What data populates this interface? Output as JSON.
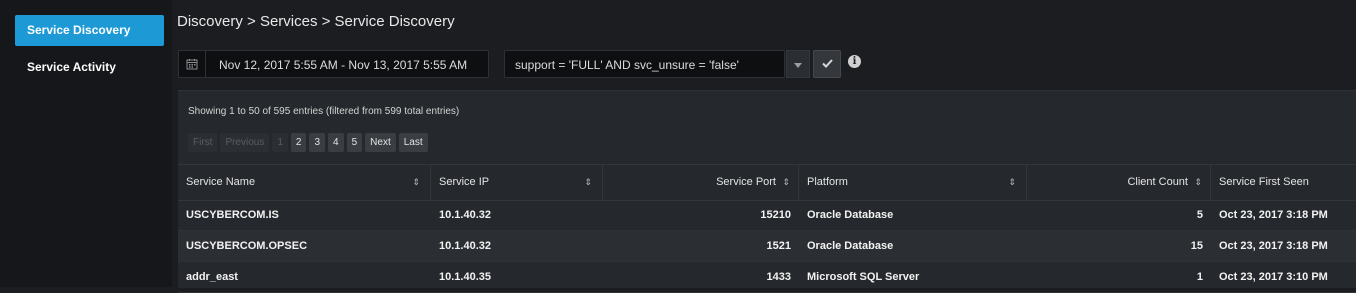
{
  "sidebar": {
    "items": [
      {
        "label": "Service Discovery",
        "active": true
      },
      {
        "label": "Service Activity",
        "active": false
      }
    ]
  },
  "breadcrumb": "Discovery > Services > Service Discovery",
  "filters": {
    "date_range": "Nov 12, 2017 5:55 AM - Nov 13, 2017 5:55 AM",
    "query": "support = 'FULL' AND svc_unsure = 'false'"
  },
  "table": {
    "showing": "Showing 1 to 50 of 595 entries (filtered from 599 total entries)",
    "pager": {
      "first": "First",
      "previous": "Previous",
      "pages": [
        "1",
        "2",
        "3",
        "4",
        "5"
      ],
      "current_page": "1",
      "next": "Next",
      "last": "Last"
    },
    "columns": {
      "service_name": "Service Name",
      "service_ip": "Service IP",
      "service_port": "Service Port",
      "platform": "Platform",
      "client_count": "Client Count",
      "first_seen": "Service First Seen"
    },
    "rows": [
      {
        "name": "USCYBERCOM.IS",
        "ip": "10.1.40.32",
        "port": "15210",
        "platform": "Oracle Database",
        "clients": "5",
        "first_seen": "Oct 23, 2017 3:18 PM"
      },
      {
        "name": "USCYBERCOM.OPSEC",
        "ip": "10.1.40.32",
        "port": "1521",
        "platform": "Oracle Database",
        "clients": "15",
        "first_seen": "Oct 23, 2017 3:18 PM"
      },
      {
        "name": "addr_east",
        "ip": "10.1.40.35",
        "port": "1433",
        "platform": "Microsoft SQL Server",
        "clients": "1",
        "first_seen": "Oct 23, 2017 3:10 PM"
      }
    ]
  },
  "colors": {
    "accent": "#1d9ad6",
    "background": "#1b1d21",
    "panel": "#25282c"
  }
}
